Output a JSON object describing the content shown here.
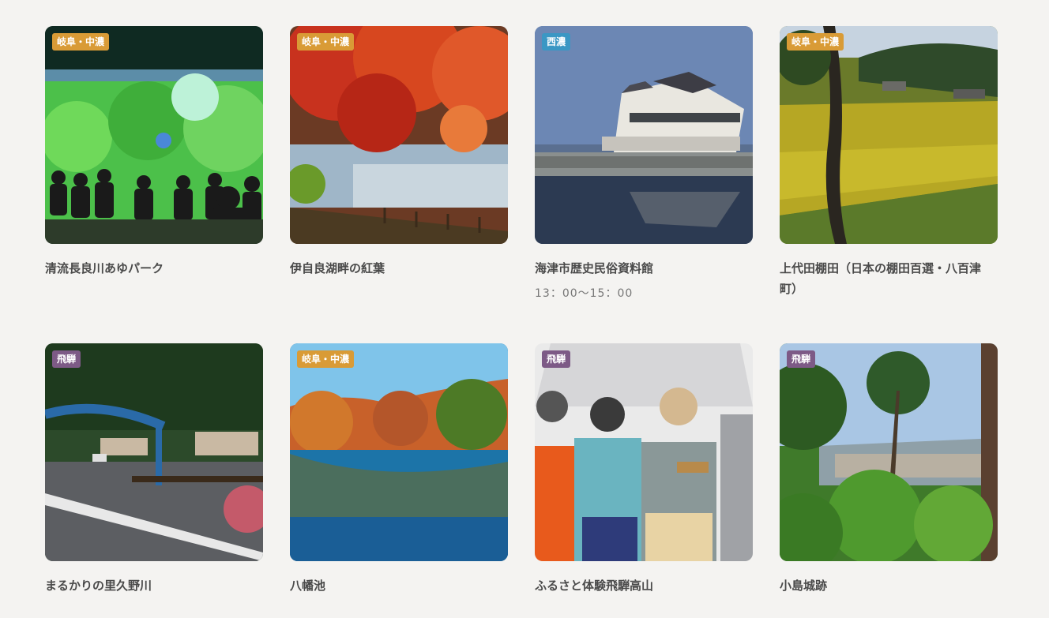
{
  "cards": [
    {
      "badge": "岐阜・中濃",
      "title": "清流長良川あゆパーク",
      "time": ""
    },
    {
      "badge": "岐阜・中濃",
      "title": "伊自良湖畔の紅葉",
      "time": ""
    },
    {
      "badge": "西濃",
      "title": "海津市歴史民俗資料館",
      "time": "13：00〜15：00"
    },
    {
      "badge": "岐阜・中濃",
      "title": "上代田棚田（日本の棚田百選・八百津町）",
      "time": ""
    },
    {
      "badge": "飛騨",
      "title": "まるかりの里久野川",
      "time": ""
    },
    {
      "badge": "岐阜・中濃",
      "title": "八幡池",
      "time": ""
    },
    {
      "badge": "飛騨",
      "title": "ふるさと体験飛騨高山",
      "time": ""
    },
    {
      "badge": "飛騨",
      "title": "小島城跡",
      "time": ""
    }
  ],
  "badge_colors": {
    "岐阜・中濃": "#d99b36",
    "西濃": "#3b97c4",
    "飛騨": "#7d5a86"
  }
}
